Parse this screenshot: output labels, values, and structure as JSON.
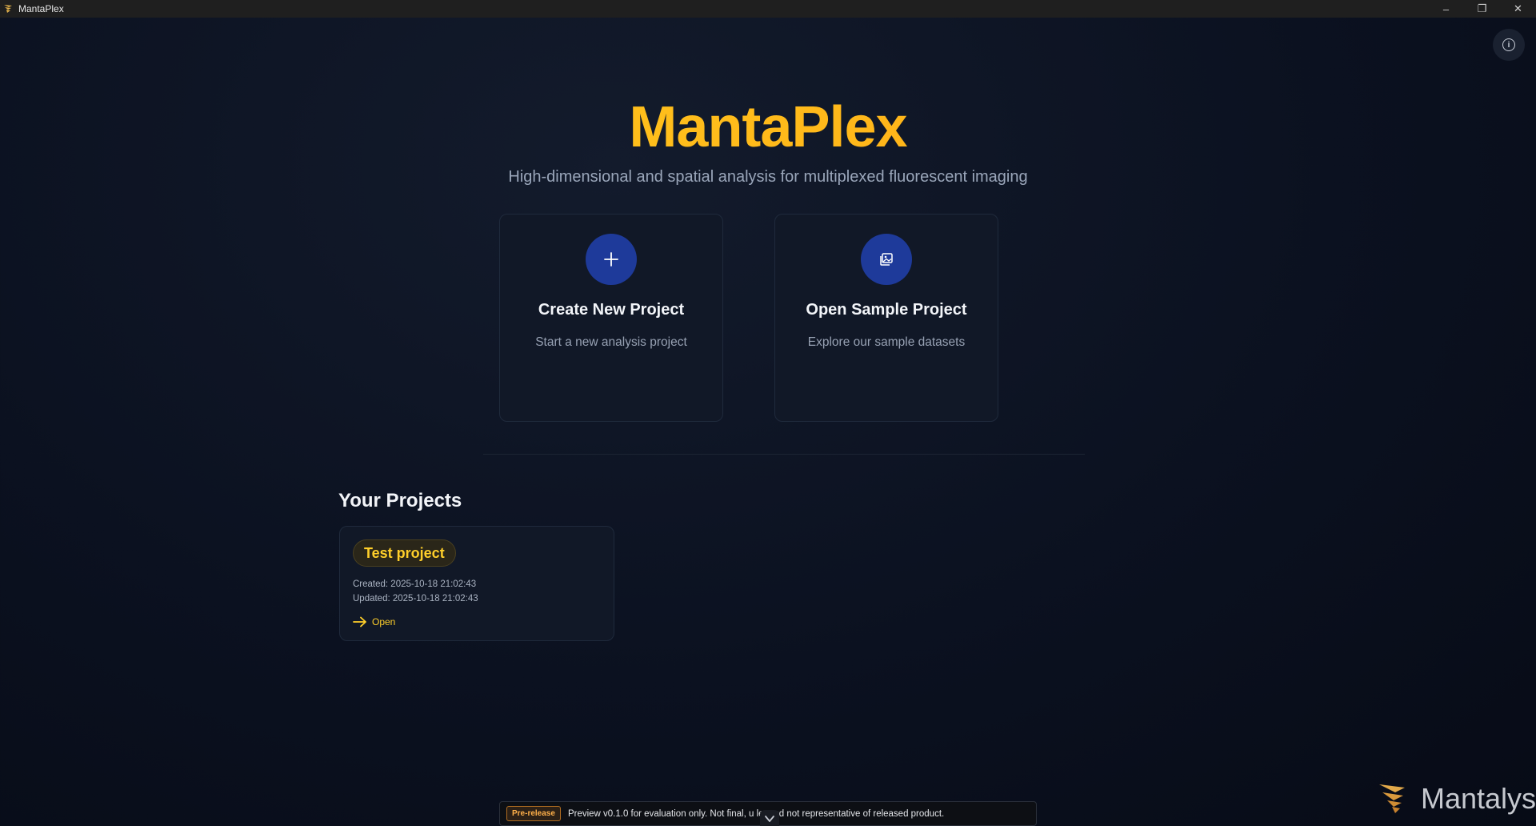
{
  "window": {
    "title": "MantaPlex",
    "controls": {
      "minimize": "–",
      "restore": "❐",
      "close": "✕"
    }
  },
  "info_button": {
    "icon": "info-icon",
    "glyph": "i"
  },
  "hero": {
    "title": "MantaPlex",
    "subtitle": "High-dimensional and spatial analysis for multiplexed fluorescent imaging"
  },
  "actions": [
    {
      "icon": "plus-icon",
      "title": "Create New Project",
      "description": "Start a new analysis project"
    },
    {
      "icon": "image-gallery-icon",
      "title": "Open Sample Project",
      "description": "Explore our sample datasets"
    }
  ],
  "projects": {
    "heading": "Your Projects",
    "items": [
      {
        "name": "Test project",
        "created": "Created: 2025-10-18 21:02:43",
        "updated": "Updated: 2025-10-18 21:02:43",
        "open_label": "Open"
      }
    ]
  },
  "banner": {
    "badge": "Pre-release",
    "text": "Preview v0.1.0 for evaluation only. Not final, u        le, and not representative of released product."
  },
  "brand": {
    "name": "Mantalys"
  },
  "colors": {
    "accent": "#ffc21a",
    "icon_circle": "#1e3a9a",
    "card_bg": "#111827",
    "background": "#0b1120"
  }
}
